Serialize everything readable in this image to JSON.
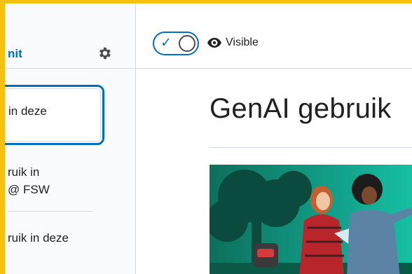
{
  "sidebar": {
    "edit_label": "nit",
    "items": [
      {
        "label_line1": "in deze"
      },
      {
        "label_line1": "ruik in",
        "label_line2": "@ FSW"
      },
      {
        "label_line1": "ruik in deze"
      }
    ]
  },
  "toolbar": {
    "visibility_label": "Visible",
    "toggle_state": "on"
  },
  "main": {
    "title": "GenAI gebruik"
  },
  "colors": {
    "frame": "#f6c00f",
    "accent": "#006fbf",
    "sidebar_bg": "#f9fbff"
  },
  "icons": [
    "gear-icon",
    "check-icon",
    "eye-icon"
  ]
}
